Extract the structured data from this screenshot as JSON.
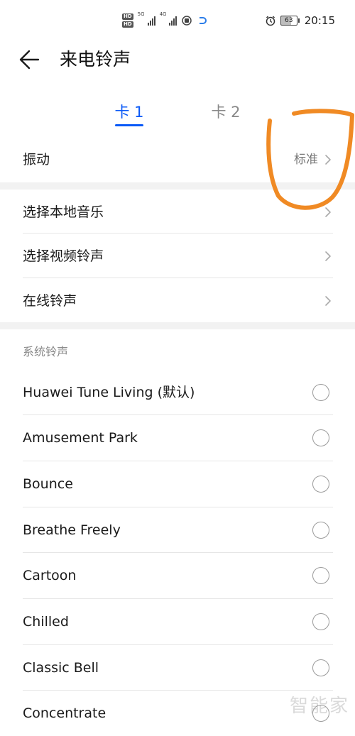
{
  "status_bar": {
    "hd_1": "HD",
    "hd_2": "HD",
    "net_5g": "5G",
    "net_4g": "4G",
    "battery": "63",
    "time": "20:15"
  },
  "header": {
    "title": "来电铃声"
  },
  "tabs": [
    {
      "label": "卡 1",
      "active": true
    },
    {
      "label": "卡 2",
      "active": false
    }
  ],
  "vibration": {
    "label": "振动",
    "value": "标准"
  },
  "options": [
    {
      "label": "选择本地音乐"
    },
    {
      "label": "选择视频铃声"
    },
    {
      "label": "在线铃声"
    }
  ],
  "system_ringtones": {
    "section_label": "系统铃声",
    "items": [
      {
        "label": "Huawei Tune Living (默认)"
      },
      {
        "label": "Amusement Park"
      },
      {
        "label": "Bounce"
      },
      {
        "label": "Breathe Freely"
      },
      {
        "label": "Cartoon"
      },
      {
        "label": "Chilled"
      },
      {
        "label": "Classic Bell"
      },
      {
        "label": "Concentrate"
      }
    ]
  },
  "watermark": "智能家",
  "colors": {
    "accent": "#0a59f7",
    "annotation": "#f08a24"
  }
}
